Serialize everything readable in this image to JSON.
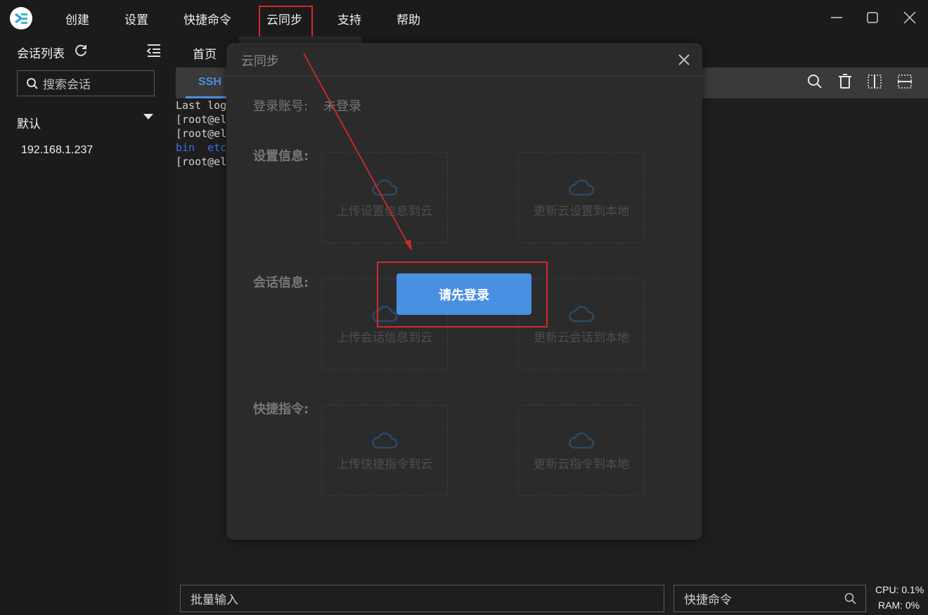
{
  "menu": {
    "items": [
      "创建",
      "设置",
      "快捷命令",
      "云同步",
      "支持",
      "帮助"
    ]
  },
  "sidebar": {
    "title": "会话列表",
    "search_placeholder": "搜索会话",
    "group": "默认",
    "sessions": [
      "192.168.1.237"
    ]
  },
  "tabs": {
    "home": "首页",
    "ssh": "SSH"
  },
  "terminal": {
    "lines": [
      "Last log",
      "[root@el",
      "[root@el",
      "bin  etc",
      "[root@el"
    ]
  },
  "modal": {
    "title": "云同步",
    "account_label": "登录账号:",
    "account_value": "未登录",
    "sections": [
      {
        "label": "设置信息:",
        "upload": "上传设置信息到云",
        "download": "更新云设置到本地"
      },
      {
        "label": "会话信息:",
        "upload": "上传会话信息到云",
        "download": "更新云会话到本地"
      },
      {
        "label": "快捷指令:",
        "upload": "上传快捷指令到云",
        "download": "更新云指令到本地"
      }
    ],
    "login_button": "请先登录"
  },
  "bottom": {
    "batch_input_placeholder": "批量输入",
    "command_placeholder": "快捷命令",
    "cpu": "CPU: 0.1%",
    "ram": "RAM: 0%"
  },
  "colors": {
    "accent": "#4a90e2",
    "annotation": "#d62828"
  }
}
